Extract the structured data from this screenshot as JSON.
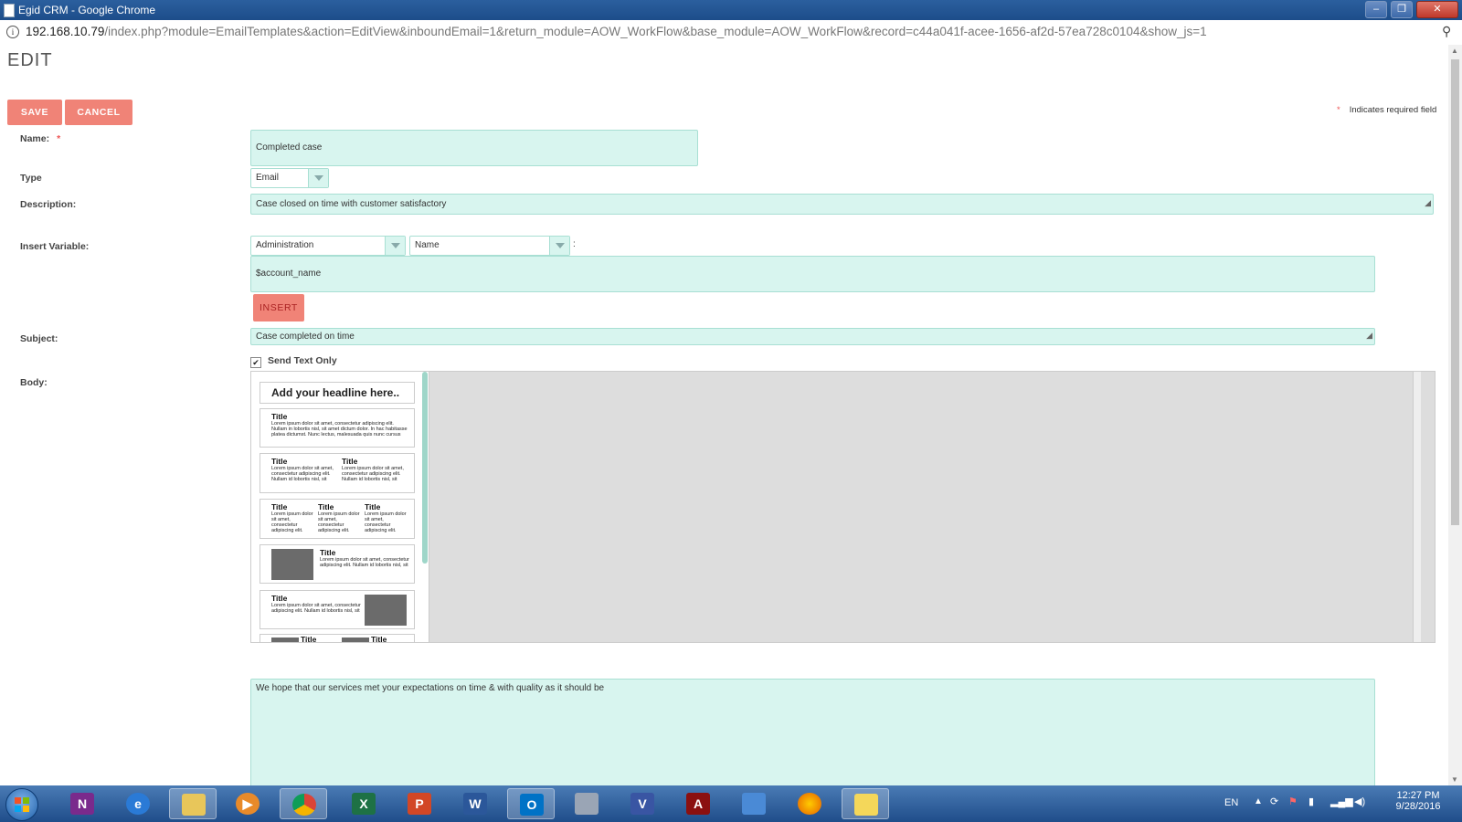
{
  "window": {
    "title": "Egid CRM - Google Chrome",
    "controls": [
      "–",
      "❐",
      "✕"
    ]
  },
  "address": {
    "host": "192.168.10.79",
    "path": "/index.php?module=EmailTemplates&action=EditView&inboundEmail=1&return_module=AOW_WorkFlow&base_module=AOW_WorkFlow&record=c44a041f-acee-1656-af2d-57ea728c0104&show_js=1"
  },
  "page": {
    "heading": "EDIT",
    "save_label": "SAVE",
    "cancel_label": "CANCEL",
    "required_note": "Indicates required field",
    "required_star": "*"
  },
  "form": {
    "name_label": "Name:",
    "name_value": "Completed case",
    "type_label": "Type",
    "type_value": "Email",
    "description_label": "Description:",
    "description_value": "Case closed on time with customer satisfactory",
    "insert_variable_label": "Insert Variable:",
    "module_select": "Administration",
    "field_select": "Name",
    "separator": ":",
    "variable_value": "$account_name",
    "insert_label": "INSERT",
    "subject_label": "Subject:",
    "subject_value": "Case completed on time",
    "send_text_only_label": "Send Text Only",
    "send_text_only_checked": true,
    "body_label": "Body:",
    "text_body": "We hope that our services met your expectations on time & with quality as it should be"
  },
  "templates": {
    "headline": "Add your headline here..",
    "title": "Title",
    "lorem_one_col": "Lorem ipsum dolor sit amet, consectetur adipiscing elit. Nullam in lobortis nisl, sit amet dictum dolor. In hac habitasse platea dictumst. Nunc lectus, malesuada quis nunc cursus",
    "lorem_two_col": "Lorem ipsum dolor sit amet, consectetur adipiscing elit. Nullam id lobortis nisl, sit",
    "lorem_three_col": "Lorem ipsum dolor sit amet, consectetur adipiscing elit.",
    "lorem_img_right": "Lorem ipsum dolor sit amet, consectetur adipiscing elit. Nullam id lobortis nisl, sit",
    "lorem_img_left": "Lorem ipsum dolor sit amet, consectetur adipiscing elit. Nullam id lobortis nisl, sit"
  },
  "taskbar": {
    "apps": [
      "onenote",
      "internet-explorer",
      "file-explorer",
      "media-player",
      "chrome",
      "excel",
      "powerpoint",
      "word",
      "outlook",
      "calculator",
      "visio",
      "acrobat",
      "remote-desktop",
      "firefox",
      "folder"
    ],
    "language": "EN",
    "time": "12:27 PM",
    "date": "9/28/2016"
  }
}
